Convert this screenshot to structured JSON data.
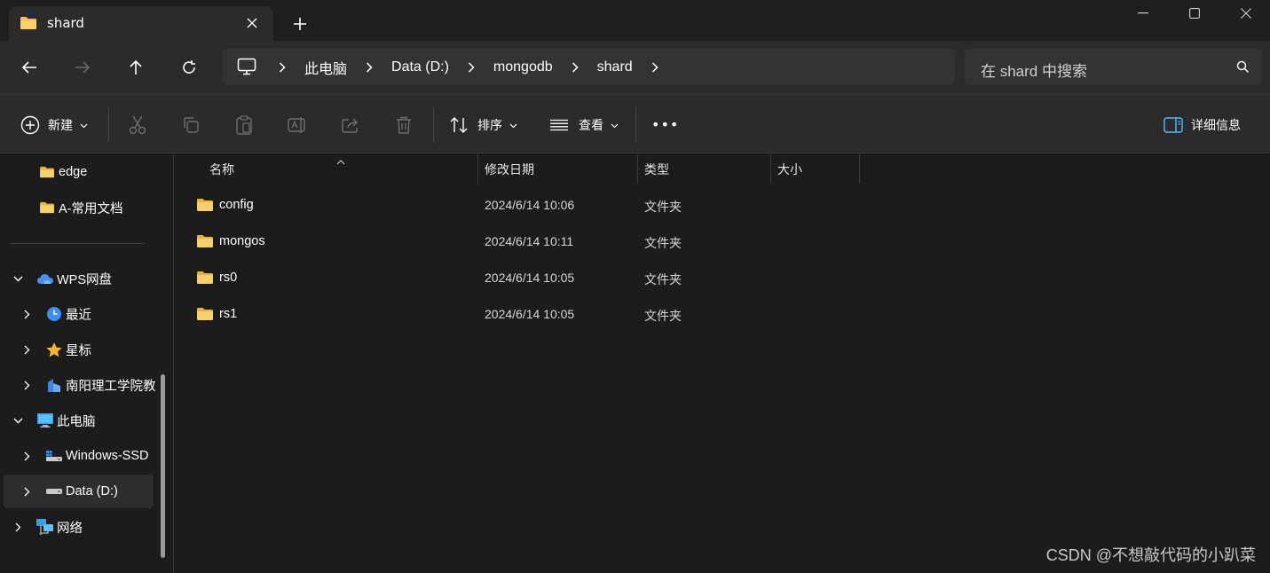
{
  "tab": {
    "title": "shard",
    "new_tab_label": "+"
  },
  "address": {
    "crumbs": [
      "此电脑",
      "Data (D:)",
      "mongodb",
      "shard"
    ]
  },
  "search": {
    "placeholder": "在 shard 中搜索"
  },
  "commands": {
    "new_label": "新建",
    "sort_label": "排序",
    "view_label": "查看",
    "more_label": "•••",
    "details_label": "详细信息"
  },
  "sidebar": {
    "items": [
      {
        "label": "edge",
        "icon": "folder-icon"
      },
      {
        "label": "A-常用文档",
        "icon": "folder-icon"
      },
      {
        "label": "WPS网盘",
        "icon": "cloud-icon"
      },
      {
        "label": "最近",
        "icon": "clock-icon"
      },
      {
        "label": "星标",
        "icon": "star-icon"
      },
      {
        "label": "南阳理工学院教",
        "icon": "building-icon"
      },
      {
        "label": "此电脑",
        "icon": "monitor-icon"
      },
      {
        "label": "Windows-SSD",
        "icon": "drive-icon"
      },
      {
        "label": "Data (D:)",
        "icon": "drive-icon"
      },
      {
        "label": "网络",
        "icon": "network-icon"
      }
    ]
  },
  "columns": {
    "name": "名称",
    "modified": "修改日期",
    "type": "类型",
    "size": "大小"
  },
  "files": [
    {
      "name": "config",
      "modified": "2024/6/14 10:06",
      "type": "文件夹"
    },
    {
      "name": "mongos",
      "modified": "2024/6/14 10:11",
      "type": "文件夹"
    },
    {
      "name": "rs0",
      "modified": "2024/6/14 10:05",
      "type": "文件夹"
    },
    {
      "name": "rs1",
      "modified": "2024/6/14 10:05",
      "type": "文件夹"
    }
  ],
  "watermark": "CSDN @不想敲代码的小趴菜",
  "colors": {
    "folder": "#f2c14e",
    "accent": "#4cc2ff"
  }
}
